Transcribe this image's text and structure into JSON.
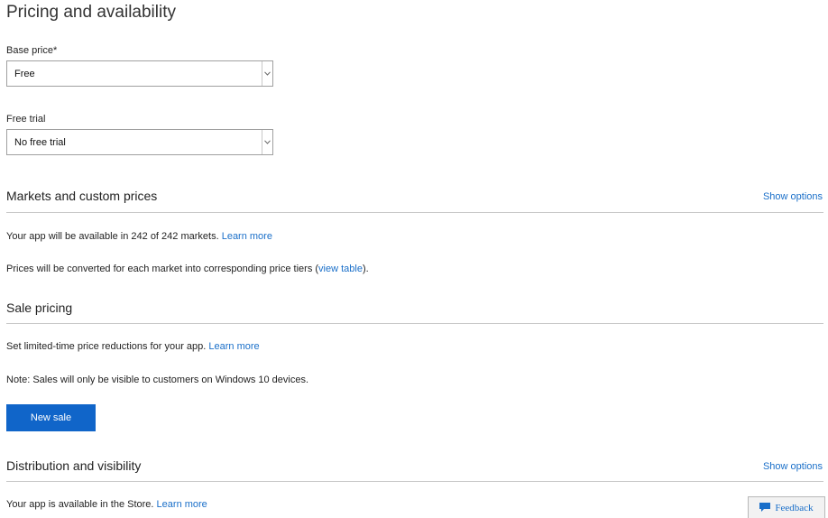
{
  "page": {
    "title": "Pricing and availability"
  },
  "base_price": {
    "label": "Base price*",
    "value": "Free"
  },
  "free_trial": {
    "label": "Free trial",
    "value": "No free trial"
  },
  "markets": {
    "heading": "Markets and custom prices",
    "show_options": "Show options",
    "availability_text": "Your app will be available in 242 of 242 markets.",
    "availability_link": "Learn more",
    "prices_text_before": "Prices will be converted for each market into corresponding price tiers (",
    "prices_link": "view table",
    "prices_text_after": ")."
  },
  "sale_pricing": {
    "heading": "Sale pricing",
    "description": "Set limited-time price reductions for your app.",
    "description_link": "Learn more",
    "note": "Note: Sales will only be visible to customers on Windows 10 devices.",
    "new_sale_label": "New sale"
  },
  "distribution": {
    "heading": "Distribution and visibility",
    "show_options": "Show options",
    "availability_text": "Your app is available in the Store.",
    "availability_link": "Learn more"
  },
  "feedback": {
    "label": "Feedback",
    "icon": "speech-bubble-icon"
  },
  "colors": {
    "accent": "#1065c9",
    "link": "#1a6fc9",
    "rule": "#c8c8c8"
  }
}
